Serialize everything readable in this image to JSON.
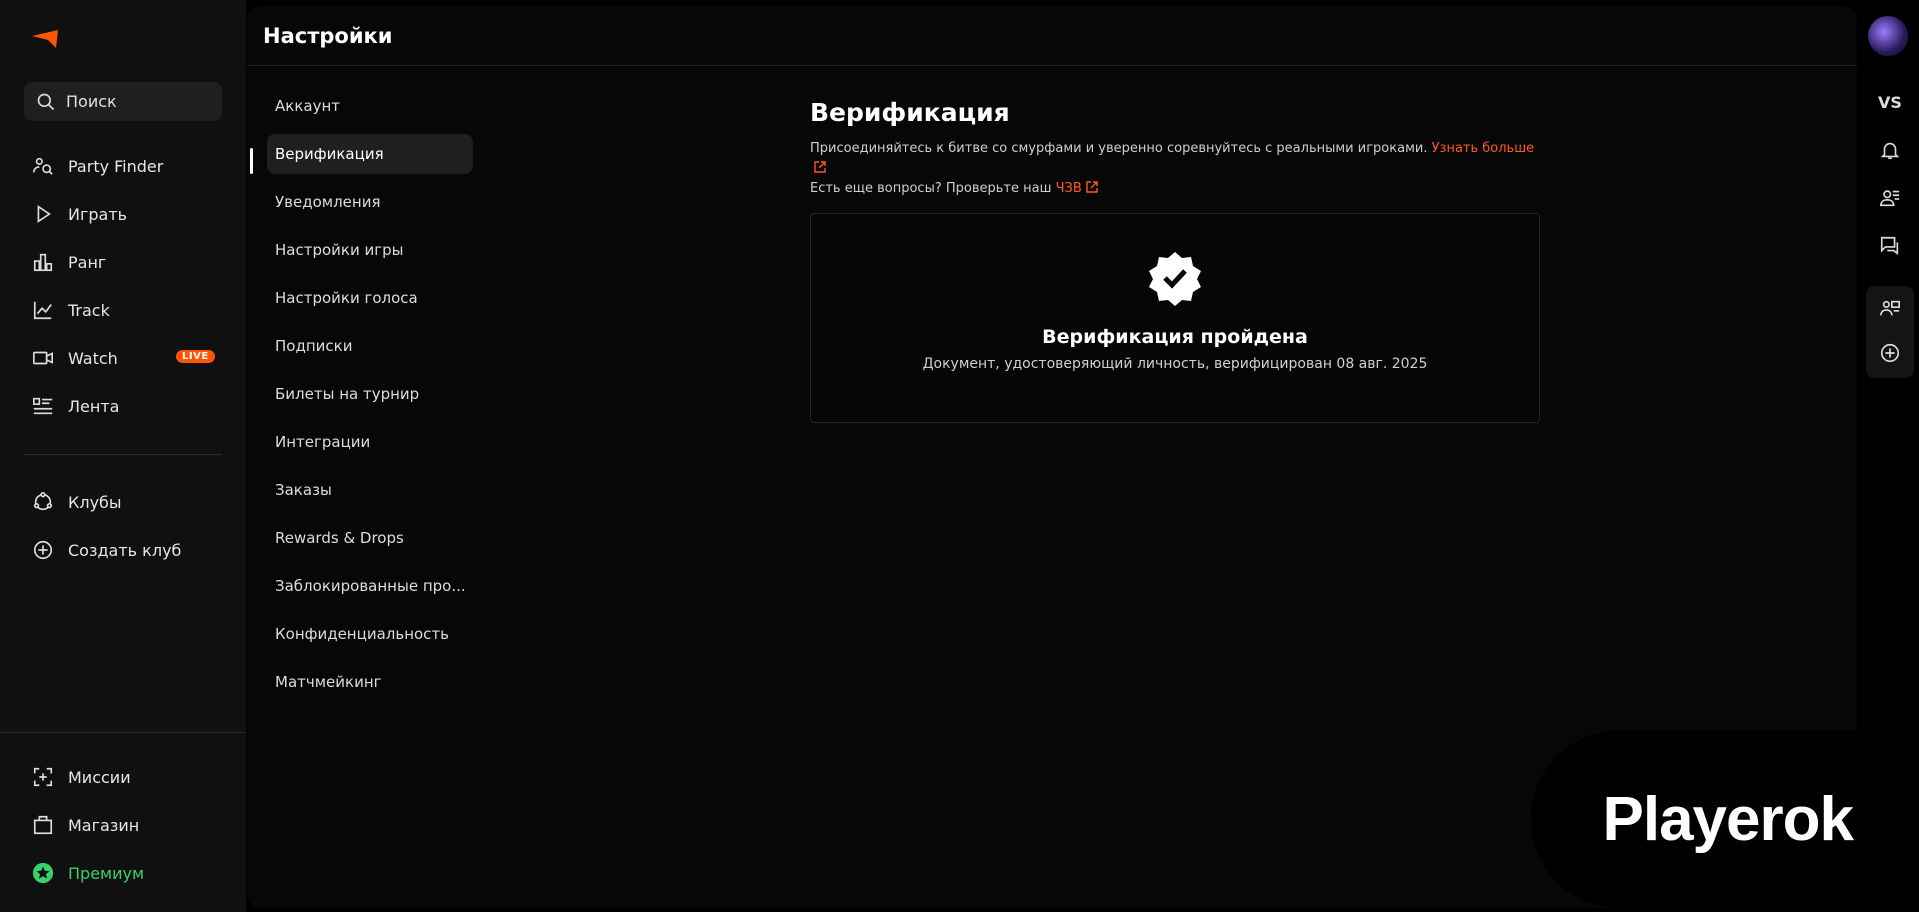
{
  "sidebar": {
    "search_label": "Поиск",
    "nav_main": [
      {
        "label": "Party Finder",
        "icon": "party-finder-icon"
      },
      {
        "label": "Играть",
        "icon": "play-icon"
      },
      {
        "label": "Ранг",
        "icon": "rank-icon"
      },
      {
        "label": "Track",
        "icon": "track-icon"
      },
      {
        "label": "Watch",
        "icon": "video-icon",
        "badge": "LIVE"
      },
      {
        "label": "Лента",
        "icon": "feed-icon"
      }
    ],
    "nav_clubs": [
      {
        "label": "Клубы",
        "icon": "clubs-icon"
      },
      {
        "label": "Создать клуб",
        "icon": "plus-circle-icon"
      }
    ],
    "nav_bottom": [
      {
        "label": "Миссии",
        "icon": "missions-icon"
      },
      {
        "label": "Магазин",
        "icon": "shop-icon"
      },
      {
        "label": "Премиум",
        "icon": "premium-icon",
        "color": "#3ad16a"
      }
    ]
  },
  "header": {
    "title": "Настройки"
  },
  "settings_nav": {
    "active_index": 1,
    "items": [
      "Аккаунт",
      "Верификация",
      "Уведомления",
      "Настройки игры",
      "Настройки голоса",
      "Подписки",
      "Билеты на турнир",
      "Интеграции",
      "Заказы",
      "Rewards & Drops",
      "Заблокированные про...",
      "Конфиденциальность",
      "Матчмейкинг"
    ]
  },
  "verification": {
    "title": "Верификация",
    "desc_line1": "Присоединяйтесь к битве со смурфами и уверенно соревнуйтесь с реальными игроками.",
    "learn_more": "Узнать больше",
    "desc_line2": "Есть еще вопросы? Проверьте наш",
    "faq_link": "ЧЗВ",
    "status_title": "Верификация пройдена",
    "status_sub": "Документ, удостоверяющий личность, верифицирован 08 авг. 2025"
  },
  "right_rail": {
    "vs_label": "VS"
  },
  "watermark": "Playerok",
  "colors": {
    "accent": "#ff5a1f",
    "premium": "#3ad16a",
    "live_badge": "#ff5500"
  }
}
